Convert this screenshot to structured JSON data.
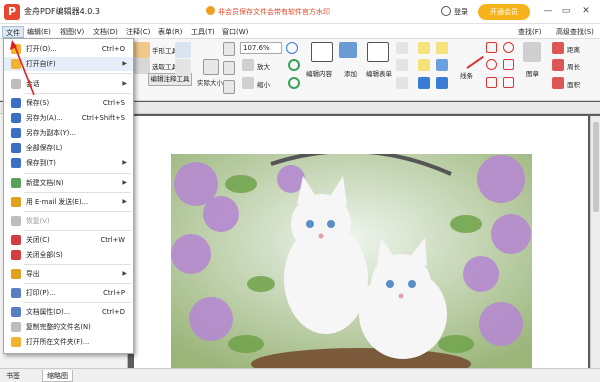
{
  "app": {
    "title": "金舟PDF编辑器4.0.3",
    "logo_letter": "P",
    "promo_text": "非会员保存文件会带有软件官方水印",
    "login_label": "登录",
    "vip_label": "开通会员",
    "win_minimize": "—",
    "win_restore": "▭",
    "win_close": "✕"
  },
  "menubar": {
    "items": [
      "文件",
      "编辑(E)",
      "视图(V)",
      "文档(D)",
      "注释(C)",
      "表单(R)",
      "工具(T)",
      "窗口(W)"
    ],
    "right": [
      "查找(F)",
      "高级查找(S)"
    ]
  },
  "toolbar": {
    "hand_tool": "手形工具",
    "select_tool": "选取工具",
    "annot_tool": "编辑注释工具",
    "actual_size": "实际大小",
    "zoom_value": "107.6%",
    "zoom_in": "放大",
    "zoom_out": "缩小",
    "edit_content": "编辑内容",
    "add": "添加",
    "edit_form": "编辑表单",
    "line": "线条",
    "stamp": "图章",
    "distance": "距离",
    "perimeter": "周长",
    "area": "面积"
  },
  "file_menu": {
    "items": [
      {
        "label": "打开(O)...",
        "shortcut": "Ctrl+O",
        "arrow": "",
        "icon_color": "#f2b233",
        "disabled": false,
        "hl": false
      },
      {
        "label": "打开自(F)",
        "shortcut": "",
        "arrow": "▶",
        "icon_color": "#f2b233",
        "disabled": false,
        "hl": true
      },
      {
        "label": "会话",
        "shortcut": "",
        "arrow": "▶",
        "icon_color": "#bdbdbd",
        "disabled": false,
        "hl": false
      },
      {
        "label": "保存(S)",
        "shortcut": "Ctrl+S",
        "arrow": "",
        "icon_color": "#3b6fc4",
        "disabled": false,
        "hl": false
      },
      {
        "label": "另存为(A)...",
        "shortcut": "Ctrl+Shift+S",
        "arrow": "",
        "icon_color": "#3b6fc4",
        "disabled": false,
        "hl": false
      },
      {
        "label": "另存为副本(Y)...",
        "shortcut": "",
        "arrow": "",
        "icon_color": "#3b6fc4",
        "disabled": false,
        "hl": false
      },
      {
        "label": "全部保存(L)",
        "shortcut": "",
        "arrow": "",
        "icon_color": "#3b6fc4",
        "disabled": false,
        "hl": false
      },
      {
        "label": "保存到(T)",
        "shortcut": "",
        "arrow": "▶",
        "icon_color": "#3b6fc4",
        "disabled": false,
        "hl": false
      },
      {
        "label": "新建文档(N)",
        "shortcut": "",
        "arrow": "▶",
        "icon_color": "#5aa05a",
        "disabled": false,
        "hl": false
      },
      {
        "label": "用 E-mail 发送(E)...",
        "shortcut": "",
        "arrow": "▶",
        "icon_color": "#e0a020",
        "disabled": false,
        "hl": false
      },
      {
        "label": "恢复(V)",
        "shortcut": "",
        "arrow": "",
        "icon_color": "#bdbdbd",
        "disabled": true,
        "hl": false
      },
      {
        "label": "关闭(C)",
        "shortcut": "Ctrl+W",
        "arrow": "",
        "icon_color": "#d04040",
        "disabled": false,
        "hl": false
      },
      {
        "label": "关闭全部(S)",
        "shortcut": "",
        "arrow": "",
        "icon_color": "#d04040",
        "disabled": false,
        "hl": false
      },
      {
        "label": "导出",
        "shortcut": "",
        "arrow": "▶",
        "icon_color": "#e0a020",
        "disabled": false,
        "hl": false
      },
      {
        "label": "打印(P)...",
        "shortcut": "Ctrl+P",
        "arrow": "",
        "icon_color": "#5a7fc0",
        "disabled": false,
        "hl": false
      },
      {
        "label": "文档属性(D)...",
        "shortcut": "Ctrl+D",
        "arrow": "",
        "icon_color": "#5a7fc0",
        "disabled": false,
        "hl": false
      },
      {
        "label": "复制完整的文件名(N)",
        "shortcut": "",
        "arrow": "",
        "icon_color": "#bdbdbd",
        "disabled": false,
        "hl": false
      },
      {
        "label": "打开所在文件夹(F)...",
        "shortcut": "",
        "arrow": "",
        "icon_color": "#f2b233",
        "disabled": false,
        "hl": false
      }
    ]
  },
  "statusbar": {
    "tabs": [
      "书签",
      "缩略图"
    ],
    "active": "缩略图"
  },
  "colors": {
    "accent": "#e8452e",
    "vip": "#f5b21b",
    "menu_highlight": "#e5eef9"
  }
}
